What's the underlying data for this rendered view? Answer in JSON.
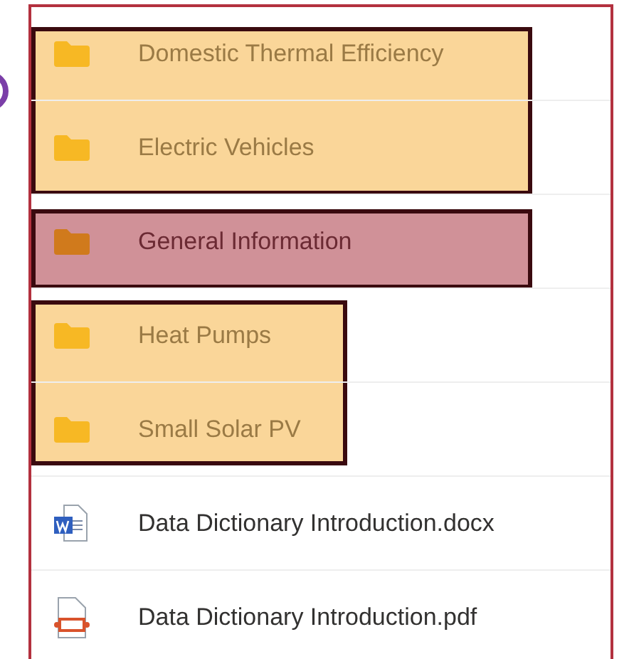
{
  "entries": [
    {
      "kind": "group",
      "color": "#fad699",
      "items": [
        {
          "kind": "folder",
          "name": "Domestic Thermal Efficiency"
        },
        {
          "kind": "folder",
          "name": "Electric Vehicles"
        }
      ]
    },
    {
      "kind": "group",
      "color": "#d09198",
      "items": [
        {
          "kind": "folder",
          "name": "General Information"
        }
      ]
    },
    {
      "kind": "group",
      "color": "#fad699",
      "items": [
        {
          "kind": "folder",
          "name": "Heat Pumps"
        },
        {
          "kind": "folder",
          "name": "Small Solar PV"
        }
      ]
    },
    {
      "kind": "docx",
      "name": "Data Dictionary Introduction.docx"
    },
    {
      "kind": "pdf",
      "name": "Data Dictionary Introduction.pdf"
    }
  ]
}
